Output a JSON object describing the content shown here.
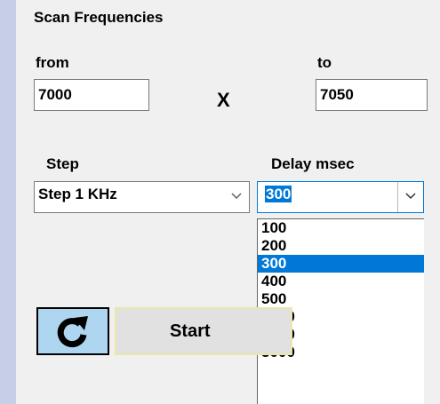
{
  "title": "Scan Frequencies",
  "from": {
    "label": "from",
    "value": "7000"
  },
  "separator": "X",
  "to": {
    "label": "to",
    "value": "7050"
  },
  "step": {
    "label": "Step",
    "selected": "Step 1 KHz"
  },
  "delay": {
    "label": "Delay  msec",
    "selected": "300",
    "options": [
      "100",
      "200",
      "300",
      "400",
      "500",
      "1000",
      "2000",
      "3000"
    ]
  },
  "buttons": {
    "refresh_icon": "refresh-icon",
    "start_label": "Start"
  },
  "colors": {
    "selection": "#0078d7",
    "refresh_bg": "#aed6f0",
    "window_bg": "#c7cfe6"
  }
}
